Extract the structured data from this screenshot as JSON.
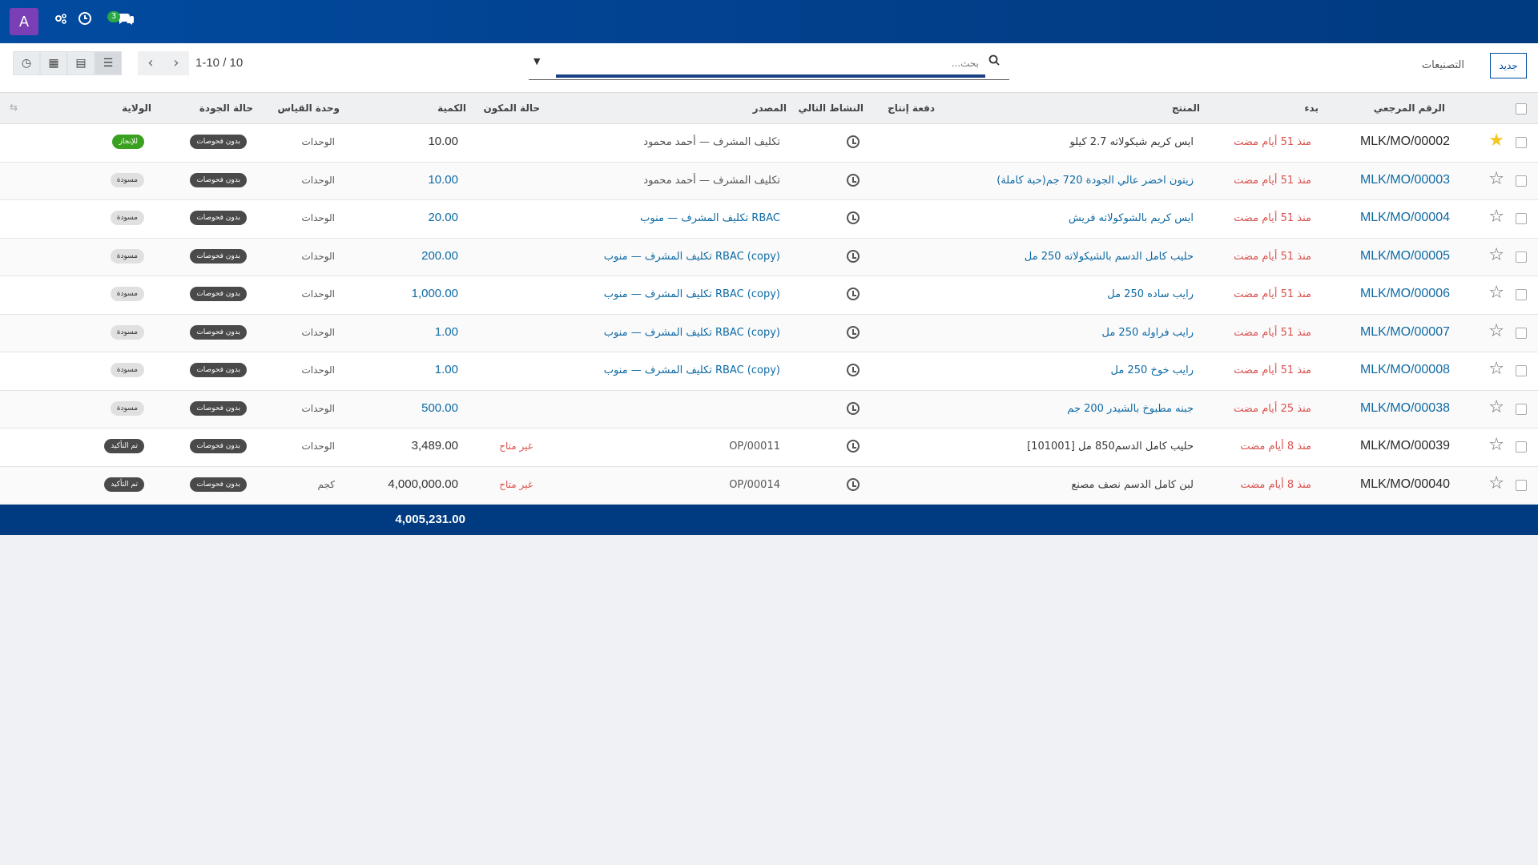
{
  "navbar": {
    "avatar_letter": "A",
    "messages_count": "3"
  },
  "control_panel": {
    "new_button": "جديد",
    "breadcrumb": "التصنيعات",
    "search_placeholder": "بحث...",
    "pager": "1-10 / 10"
  },
  "table": {
    "headers": {
      "reference": "الرقم المرجعي",
      "start": "بدء",
      "product": "المنتج",
      "lot": "دفعة إنتاج",
      "next_activity": "النشاط التالي",
      "source": "المصدر",
      "component_status": "حالة المكون",
      "quantity": "الكمية",
      "uom": "وحدة القياس",
      "quality_state": "حالة الجودة",
      "state": "الولاية"
    },
    "rows": [
      {
        "reference": "MLK/MO/00002",
        "starred": true,
        "start": "منذ 51 أيام مضت",
        "product": "ايس كريم شيكولاته 2.7 كيلو",
        "source": "تكليف المشرف — أحمد محمود",
        "component_status": "",
        "quantity": "10.00",
        "uom": "الوحدات",
        "quality": "بدون فحوصات",
        "state": "للإنجاز"
      },
      {
        "reference": "MLK/MO/00003",
        "starred": false,
        "start": "منذ 51 أيام مضت",
        "product": "زيتون اخضر عالي الجودة 720 جم(حبة كاملة)",
        "source": "تكليف المشرف — أحمد محمود",
        "component_status": "",
        "quantity": "10.00",
        "uom": "الوحدات",
        "quality": "بدون فحوصات",
        "state": "مسودة"
      },
      {
        "reference": "MLK/MO/00004",
        "starred": false,
        "start": "منذ 51 أيام مضت",
        "product": "ايس كريم بالشوكولاته فريش",
        "source": "تكليف المشرف — منوب RBAC",
        "component_status": "",
        "quantity": "20.00",
        "uom": "الوحدات",
        "quality": "بدون فحوصات",
        "state": "مسودة"
      },
      {
        "reference": "MLK/MO/00005",
        "starred": false,
        "start": "منذ 51 أيام مضت",
        "product": "حليب كامل الدسم بالشيكولاته 250 مل",
        "source": "تكليف المشرف — منوب RBAC (copy)",
        "component_status": "",
        "quantity": "200.00",
        "uom": "الوحدات",
        "quality": "بدون فحوصات",
        "state": "مسودة"
      },
      {
        "reference": "MLK/MO/00006",
        "starred": false,
        "start": "منذ 51 أيام مضت",
        "product": "رايب ساده 250 مل",
        "source": "تكليف المشرف — منوب RBAC (copy)",
        "component_status": "",
        "quantity": "1,000.00",
        "uom": "الوحدات",
        "quality": "بدون فحوصات",
        "state": "مسودة"
      },
      {
        "reference": "MLK/MO/00007",
        "starred": false,
        "start": "منذ 51 أيام مضت",
        "product": "رايب فراوله 250 مل",
        "source": "تكليف المشرف — منوب RBAC (copy)",
        "component_status": "",
        "quantity": "1.00",
        "uom": "الوحدات",
        "quality": "بدون فحوصات",
        "state": "مسودة"
      },
      {
        "reference": "MLK/MO/00008",
        "starred": false,
        "start": "منذ 51 أيام مضت",
        "product": "رايب خوخ 250 مل",
        "source": "تكليف المشرف — منوب RBAC (copy)",
        "component_status": "",
        "quantity": "1.00",
        "uom": "الوحدات",
        "quality": "بدون فحوصات",
        "state": "مسودة"
      },
      {
        "reference": "MLK/MO/00038",
        "starred": false,
        "start": "منذ 25 أيام مضت",
        "product": "جبنه مطبوخ بالشيدر 200 جم",
        "source": "",
        "component_status": "",
        "quantity": "500.00",
        "uom": "الوحدات",
        "quality": "بدون فحوصات",
        "state": "مسودة"
      },
      {
        "reference": "MLK/MO/00039",
        "starred": false,
        "start": "منذ 8 أيام مضت",
        "product": "[101001] حليب كامل الدسم850 مل",
        "source": "OP/00011",
        "component_status": "غير متاح",
        "quantity": "3,489.00",
        "uom": "الوحدات",
        "quality": "بدون فحوصات",
        "state": "تم التأكيد"
      },
      {
        "reference": "MLK/MO/00040",
        "starred": false,
        "start": "منذ 8 أيام مضت",
        "product": "لبن كامل الدسم نصف مصنع",
        "source": "OP/00014",
        "component_status": "غير متاح",
        "quantity": "4,000,000.00",
        "uom": "كجم",
        "quality": "بدون فحوصات",
        "state": "تم التأكيد"
      }
    ],
    "total_quantity": "4,005,231.00"
  },
  "colors": {
    "navbar": "#014ba0",
    "link": "#0e6aa4",
    "late": "#d9534f",
    "progress_state": "#3aa01f",
    "footer": "#003a80"
  }
}
